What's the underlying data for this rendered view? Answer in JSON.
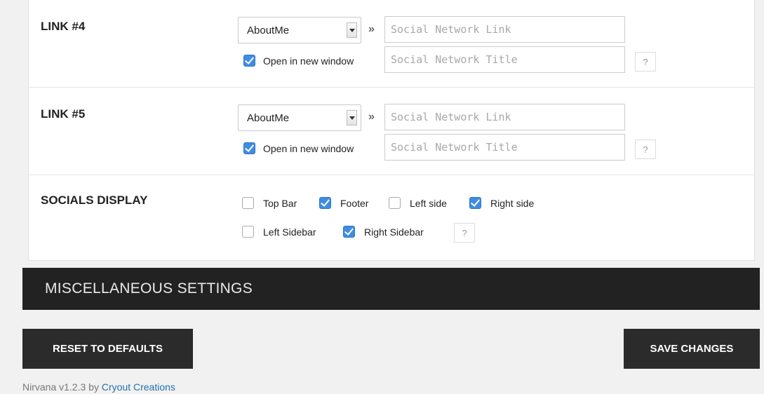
{
  "links": [
    {
      "label": "LINK #4",
      "select_value": "AboutMe",
      "separator": "»",
      "link_placeholder": "Social Network Link",
      "open_new_window_label": "Open in new window",
      "open_new_window_checked": true,
      "title_placeholder": "Social Network Title",
      "help": "?"
    },
    {
      "label": "LINK #5",
      "select_value": "AboutMe",
      "separator": "»",
      "link_placeholder": "Social Network Link",
      "open_new_window_label": "Open in new window",
      "open_new_window_checked": true,
      "title_placeholder": "Social Network Title",
      "help": "?"
    }
  ],
  "socials_display": {
    "label": "SOCIALS DISPLAY",
    "options": [
      {
        "label": "Top Bar",
        "checked": false
      },
      {
        "label": "Footer",
        "checked": true
      },
      {
        "label": "Left side",
        "checked": false
      },
      {
        "label": "Right side",
        "checked": true
      },
      {
        "label": "Left Sidebar",
        "checked": false
      },
      {
        "label": "Right Sidebar",
        "checked": true
      }
    ],
    "help": "?"
  },
  "misc_section": {
    "title": "MISCELLANEOUS SETTINGS"
  },
  "buttons": {
    "reset": "RESET TO DEFAULTS",
    "save": "SAVE CHANGES"
  },
  "footer": {
    "prefix": "Nirvana v1.2.3 by ",
    "link": "Cryout Creations"
  },
  "colors": {
    "check_accent": "#3f8de3",
    "dark_bar": "#222222",
    "link": "#2271b1"
  }
}
